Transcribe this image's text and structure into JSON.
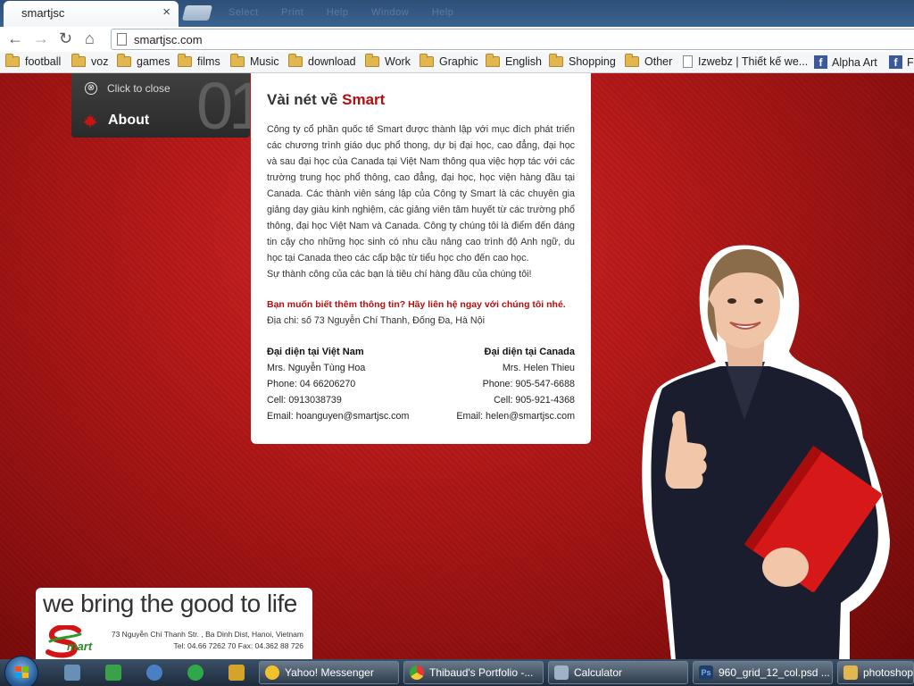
{
  "browser": {
    "tab_title": "smartjsc",
    "tab_close": "×",
    "window_menus": [
      "Select",
      "Print",
      "Help",
      "Window",
      "Help"
    ],
    "url": "smartjsc.com",
    "nav": {
      "back": "←",
      "forward": "→",
      "reload": "↻",
      "home": "⌂"
    }
  },
  "bookmarks": [
    {
      "label": "football",
      "icon": "folder-icon"
    },
    {
      "label": "voz",
      "icon": "folder-icon"
    },
    {
      "label": "games",
      "icon": "folder-icon"
    },
    {
      "label": "films",
      "icon": "folder-icon"
    },
    {
      "label": "Music",
      "icon": "folder-icon"
    },
    {
      "label": "download",
      "icon": "folder-icon"
    },
    {
      "label": "Work",
      "icon": "folder-icon"
    },
    {
      "label": "Graphic",
      "icon": "folder-icon"
    },
    {
      "label": "English",
      "icon": "folder-icon"
    },
    {
      "label": "Shopping",
      "icon": "folder-icon"
    },
    {
      "label": "Other",
      "icon": "folder-icon"
    },
    {
      "label": "Izwebz | Thiết kế we...",
      "icon": "page-icon"
    },
    {
      "label": "Alpha Art",
      "icon": "facebook-icon"
    },
    {
      "label": "F",
      "icon": "facebook-icon"
    }
  ],
  "side": {
    "close_label": "Click to close",
    "close_icon": "⊗",
    "about_label": "About",
    "section_number": "01"
  },
  "card": {
    "title_prefix": "Vài nét về",
    "title_brand": "Smart",
    "body": "Công ty cổ phần quốc tế Smart được thành lập với mục đích phát triển các chương trình giáo dục phổ thong, dự bị đại học, cao đẳng, đại học và sau đại học của Canada tại Việt Nam thông qua việc hợp tác với các trường trung học phổ thông, cao đẳng, đại học, học viện hàng đầu tại Canada. Các thành viên sáng lập của Công ty Smart là các chuyên gia giảng dạy giàu kinh nghiệm, các giảng viên tâm huyết từ các trường phổ thông, đại học Việt Nam và Canada. Công ty chúng  tôi là điểm đến đáng tin cậy cho những học sinh có nhu cầu nâng cao trình độ Anh ngữ, du học tại Canada  theo các cấp bậc từ tiểu học cho đến cao học.",
    "tagline": "Sự  thành công của các bạn là tiêu chí hàng đầu của chúng tôi!",
    "cta": "Bạn muốn biết thêm thông tin? Hãy liên hệ ngay với chúng tôi nhé.",
    "address": "Địa chi: số 73 Nguyễn Chí Thanh, Đống Đa, Hà Nội",
    "vn": {
      "heading": "Đại diện tại Việt Nam",
      "name": "Mrs. Nguyễn Tùng Hoa",
      "phone": "Phone: 04 66206270",
      "cell": "Cell: 0913038739",
      "email": "Email: hoanguyen@smartjsc.com"
    },
    "ca": {
      "heading": "Đại diện tại Canada",
      "name": "Mrs. Helen Thieu",
      "phone": "Phone: 905-547-6688",
      "cell": "Cell: 905-921-4368",
      "email": "Email: helen@smartjsc.com"
    }
  },
  "footer_logo": {
    "slogan": "we bring the good to life",
    "brand": "mart",
    "address": "73 Nguyễn Chí Thanh Str. , Ba Dinh Dist, Hanoi, Vietnam",
    "contact": "Tel: 04.66 7262 70  Fax: 04.362 88 726"
  },
  "taskbar": {
    "tasks": [
      {
        "label": "Yahoo! Messenger",
        "icon": "yahoo-messenger-icon",
        "color": "#f2c12e"
      },
      {
        "label": "Thibaud's Portfolio -...",
        "icon": "chrome-icon",
        "color": "#4a8fd6"
      },
      {
        "label": "Calculator",
        "icon": "calculator-icon",
        "color": "#9fb3c8"
      },
      {
        "label": "960_grid_12_col.psd ...",
        "icon": "photoshop-icon",
        "color": "#1d3f6e"
      },
      {
        "label": "photoshop",
        "icon": "folder-icon",
        "color": "#e3b74f"
      }
    ]
  },
  "colors": {
    "brand_red": "#b30f0f",
    "page_red": "#c41e1e",
    "panel_dark": "#333333",
    "taskbar": "#2a3b4f"
  }
}
